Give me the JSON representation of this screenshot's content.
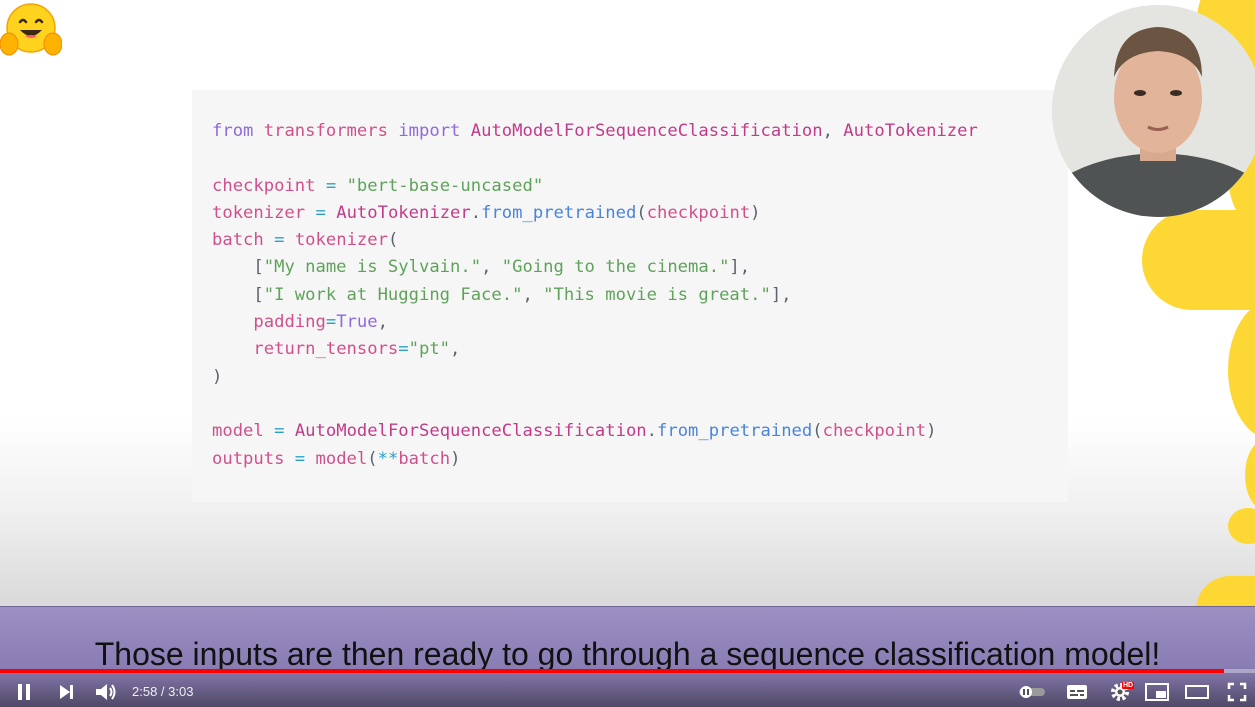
{
  "code": {
    "line1": [
      [
        "kw",
        "from"
      ],
      [
        "plain",
        " "
      ],
      [
        "var",
        "transformers"
      ],
      [
        "plain",
        " "
      ],
      [
        "kw",
        "import"
      ],
      [
        "plain",
        " "
      ],
      [
        "cls",
        "AutoModelForSequenceClassification"
      ],
      [
        "plain",
        ", "
      ],
      [
        "cls",
        "AutoTokenizer"
      ]
    ],
    "line2": [
      [
        "plain",
        ""
      ]
    ],
    "line3": [
      [
        "var",
        "checkpoint"
      ],
      [
        "plain",
        " "
      ],
      [
        "op",
        "="
      ],
      [
        "plain",
        " "
      ],
      [
        "str",
        "\"bert-base-uncased\""
      ]
    ],
    "line4": [
      [
        "var",
        "tokenizer"
      ],
      [
        "plain",
        " "
      ],
      [
        "op",
        "="
      ],
      [
        "plain",
        " "
      ],
      [
        "cls",
        "AutoTokenizer"
      ],
      [
        "plain",
        "."
      ],
      [
        "fn",
        "from_pretrained"
      ],
      [
        "plain",
        "("
      ],
      [
        "var",
        "checkpoint"
      ],
      [
        "plain",
        ")"
      ]
    ],
    "line5": [
      [
        "var",
        "batch"
      ],
      [
        "plain",
        " "
      ],
      [
        "op",
        "="
      ],
      [
        "plain",
        " "
      ],
      [
        "var",
        "tokenizer"
      ],
      [
        "plain",
        "("
      ]
    ],
    "line6": [
      [
        "plain",
        "    ["
      ],
      [
        "str",
        "\"My name is Sylvain.\""
      ],
      [
        "plain",
        ", "
      ],
      [
        "str",
        "\"Going to the cinema.\""
      ],
      [
        "plain",
        "],"
      ]
    ],
    "line7": [
      [
        "plain",
        "    ["
      ],
      [
        "str",
        "\"I work at Hugging Face.\""
      ],
      [
        "plain",
        ", "
      ],
      [
        "str",
        "\"This movie is great.\""
      ],
      [
        "plain",
        "],"
      ]
    ],
    "line8": [
      [
        "plain",
        "    "
      ],
      [
        "var",
        "padding"
      ],
      [
        "op",
        "="
      ],
      [
        "num",
        "True"
      ],
      [
        "plain",
        ","
      ]
    ],
    "line9": [
      [
        "plain",
        "    "
      ],
      [
        "var",
        "return_tensors"
      ],
      [
        "op",
        "="
      ],
      [
        "str",
        "\"pt\""
      ],
      [
        "plain",
        ","
      ]
    ],
    "line10": [
      [
        "plain",
        ")"
      ]
    ],
    "line11": [
      [
        "plain",
        ""
      ]
    ],
    "line12": [
      [
        "var",
        "model"
      ],
      [
        "plain",
        " "
      ],
      [
        "op",
        "="
      ],
      [
        "plain",
        " "
      ],
      [
        "cls",
        "AutoModelForSequenceClassification"
      ],
      [
        "plain",
        "."
      ],
      [
        "fn",
        "from_pretrained"
      ],
      [
        "plain",
        "("
      ],
      [
        "var",
        "checkpoint"
      ],
      [
        "plain",
        ")"
      ]
    ],
    "line13": [
      [
        "var",
        "outputs"
      ],
      [
        "plain",
        " "
      ],
      [
        "op",
        "="
      ],
      [
        "plain",
        " "
      ],
      [
        "var",
        "model"
      ],
      [
        "plain",
        "("
      ],
      [
        "op",
        "**"
      ],
      [
        "var",
        "batch"
      ],
      [
        "plain",
        ")"
      ]
    ]
  },
  "caption": "Those inputs are then ready to go through a sequence classification model!",
  "player": {
    "current_time": "2:58",
    "duration": "3:03",
    "time_display": "2:58 / 3:03",
    "progress_fraction": 0.975,
    "hd_badge": "HD",
    "progress_color": "#ff0000"
  },
  "icons": {
    "logo": "hugging-face-emoji-icon",
    "pause": "pause-icon",
    "next": "next-icon",
    "volume": "volume-icon",
    "autoplay": "autoplay-toggle-icon",
    "subtitles": "subtitles-icon",
    "settings": "settings-gear-icon",
    "miniplayer": "miniplayer-icon",
    "theater": "theater-mode-icon",
    "fullscreen": "fullscreen-icon"
  }
}
